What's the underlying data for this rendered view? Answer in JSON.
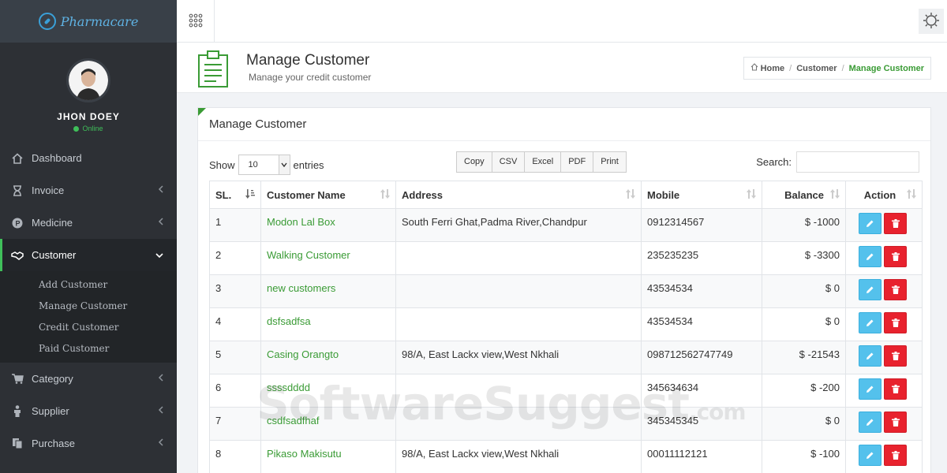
{
  "app": {
    "logo_text": "Pharmacare"
  },
  "user": {
    "name": "JHON DOEY",
    "status": "Online"
  },
  "sidebar": {
    "items": [
      {
        "label": "Dashboard",
        "icon": "home-icon"
      },
      {
        "label": "Invoice",
        "icon": "hourglass-icon"
      },
      {
        "label": "Medicine",
        "icon": "pharmacy-icon"
      },
      {
        "label": "Customer",
        "icon": "handshake-icon"
      },
      {
        "label": "Category",
        "icon": "cart-icon"
      },
      {
        "label": "Supplier",
        "icon": "person-icon"
      },
      {
        "label": "Purchase",
        "icon": "copy-icon"
      }
    ],
    "submenu": [
      "Add Customer",
      "Manage Customer",
      "Credit Customer",
      "Paid Customer"
    ]
  },
  "page": {
    "title": "Manage Customer",
    "subtitle": "Manage your credit customer"
  },
  "breadcrumb": {
    "home": "Home",
    "parent": "Customer",
    "current": "Manage Customer"
  },
  "panel": {
    "title": "Manage Customer"
  },
  "controls": {
    "show_label": "Show",
    "entries_value": "10",
    "entries_label": "entries",
    "buttons": [
      "Copy",
      "CSV",
      "Excel",
      "PDF",
      "Print"
    ],
    "search_label": "Search:"
  },
  "table": {
    "headers": [
      "SL.",
      "Customer Name",
      "Address",
      "Mobile",
      "Balance",
      "Action"
    ],
    "rows": [
      {
        "sl": "1",
        "name": "Modon Lal Box",
        "address": "South Ferri Ghat,Padma River,Chandpur",
        "mobile": "0912314567",
        "balance": "$ -1000"
      },
      {
        "sl": "2",
        "name": "Walking Customer",
        "address": "",
        "mobile": "235235235",
        "balance": "$ -3300"
      },
      {
        "sl": "3",
        "name": "new customers",
        "address": "",
        "mobile": "43534534",
        "balance": "$ 0"
      },
      {
        "sl": "4",
        "name": "dsfsadfsa",
        "address": "",
        "mobile": "43534534",
        "balance": "$ 0"
      },
      {
        "sl": "5",
        "name": "Casing Orangto",
        "address": "98/A, East Lackx view,West Nkhali",
        "mobile": "098712562747749",
        "balance": "$ -21543"
      },
      {
        "sl": "6",
        "name": "ssssdddd",
        "address": "",
        "mobile": "345634634",
        "balance": "$ -200"
      },
      {
        "sl": "7",
        "name": "csdfsadfhaf",
        "address": "",
        "mobile": "345345345",
        "balance": "$ 0"
      },
      {
        "sl": "8",
        "name": "Pikaso Makisutu",
        "address": "98/A, East Lackx view,West Nkhali",
        "mobile": "00011112121",
        "balance": "$ -100"
      }
    ]
  },
  "watermark": {
    "main": "SoftwareSuggest",
    "suffix": ".com"
  },
  "colors": {
    "accent": "#3a9b35",
    "sidebar": "#2d3035",
    "edit": "#54c1ec",
    "delete": "#e8222e"
  }
}
